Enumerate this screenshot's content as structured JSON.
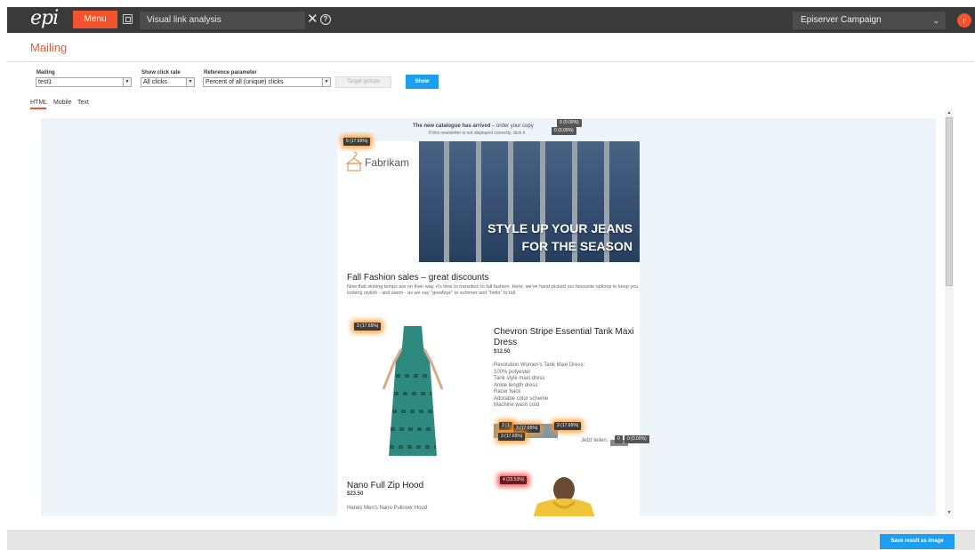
{
  "topbar": {
    "logo": "epi",
    "menu_label": "Menu",
    "tab_title": "Visual link analysis",
    "close_glyph": "✕",
    "help_glyph": "?",
    "client": "Episerver Campaign",
    "client_chevron": "⌄",
    "avatar_letter": "r"
  },
  "page": {
    "title": "Mailing"
  },
  "filters": {
    "mailing_label": "Mailing",
    "mailing_value": "test1",
    "click_rate_label": "Show click rate",
    "click_rate_value": "All clicks",
    "reference_label": "Reference parameter",
    "reference_value": "Percent of all (unique) clicks",
    "target_groups_label": "Target groups",
    "show_label": "Show",
    "arrow_glyph": "▼"
  },
  "view_tabs": {
    "html": "HTML",
    "mobile": "Mobile",
    "text": "Text",
    "active": "HTML"
  },
  "email": {
    "preheader_bold": "The new catalogue has arrived",
    "preheader_rest": " – order your copy",
    "preheader_line2": "If this newsletter is not displayed correctly, click h",
    "brand": "Fabrikam",
    "hero_line1": "STYLE UP YOUR JEANS",
    "hero_line2": "FOR THE SEASON",
    "sale_headline": "Fall Fashion sales – great discounts",
    "sale_text": "Now that sinking temps are on their way, it's time to transition to fall fashion. Here, we've hand-picked our favourite options to keep you looking stylish - and warm - as we say \"goodbye\" to summer and \"hello\" to fall.",
    "product1": {
      "title": "Chevron Stripe Essential Tank Maxi Dress",
      "price": "$12.50",
      "desc_lines": [
        "Revolution Women's Tank Maxi Dress:",
        "100% polyester",
        "Tank style maxi dress",
        "Ankle length dress",
        "Racer back",
        "Adorable color scheme",
        "Machine wash cold"
      ]
    },
    "share_text": "Jetzt teilen:",
    "product2": {
      "title": "Nano Full Zip Hood",
      "price": "$23.50",
      "desc": "Hanes Men's Nano Pullover Hood:"
    }
  },
  "badges": [
    {
      "id": "preheader-a",
      "text": "0 (0.00%)"
    },
    {
      "id": "preheader-b",
      "text": "0 (0.00%)"
    },
    {
      "id": "logo",
      "text": "5 (17.65%)"
    },
    {
      "id": "dress-image",
      "text": "3 (17.65%)"
    },
    {
      "id": "buy-1",
      "text": "3 (1"
    },
    {
      "id": "buy-2",
      "text": "3 (17.65%)"
    },
    {
      "id": "buy-3",
      "text": "3 (17.65%)"
    },
    {
      "id": "buy-4",
      "text": "3 (17.65%)"
    },
    {
      "id": "share-a",
      "text": "0"
    },
    {
      "id": "share-b",
      "text": "0 (0.00%)"
    },
    {
      "id": "hood-image",
      "text": "4 (23.53%)"
    }
  ],
  "footer": {
    "save_label": "Save result as image"
  },
  "colors": {
    "accent": "#f3542e",
    "primary_button": "#1b9ff0",
    "topbar": "#3a3a3a",
    "preview_bg": "#edf5fb"
  },
  "icons": {
    "app_switch": "app-switch-icon",
    "help": "help-icon",
    "close": "close-icon",
    "hanger": "hanger-icon"
  }
}
